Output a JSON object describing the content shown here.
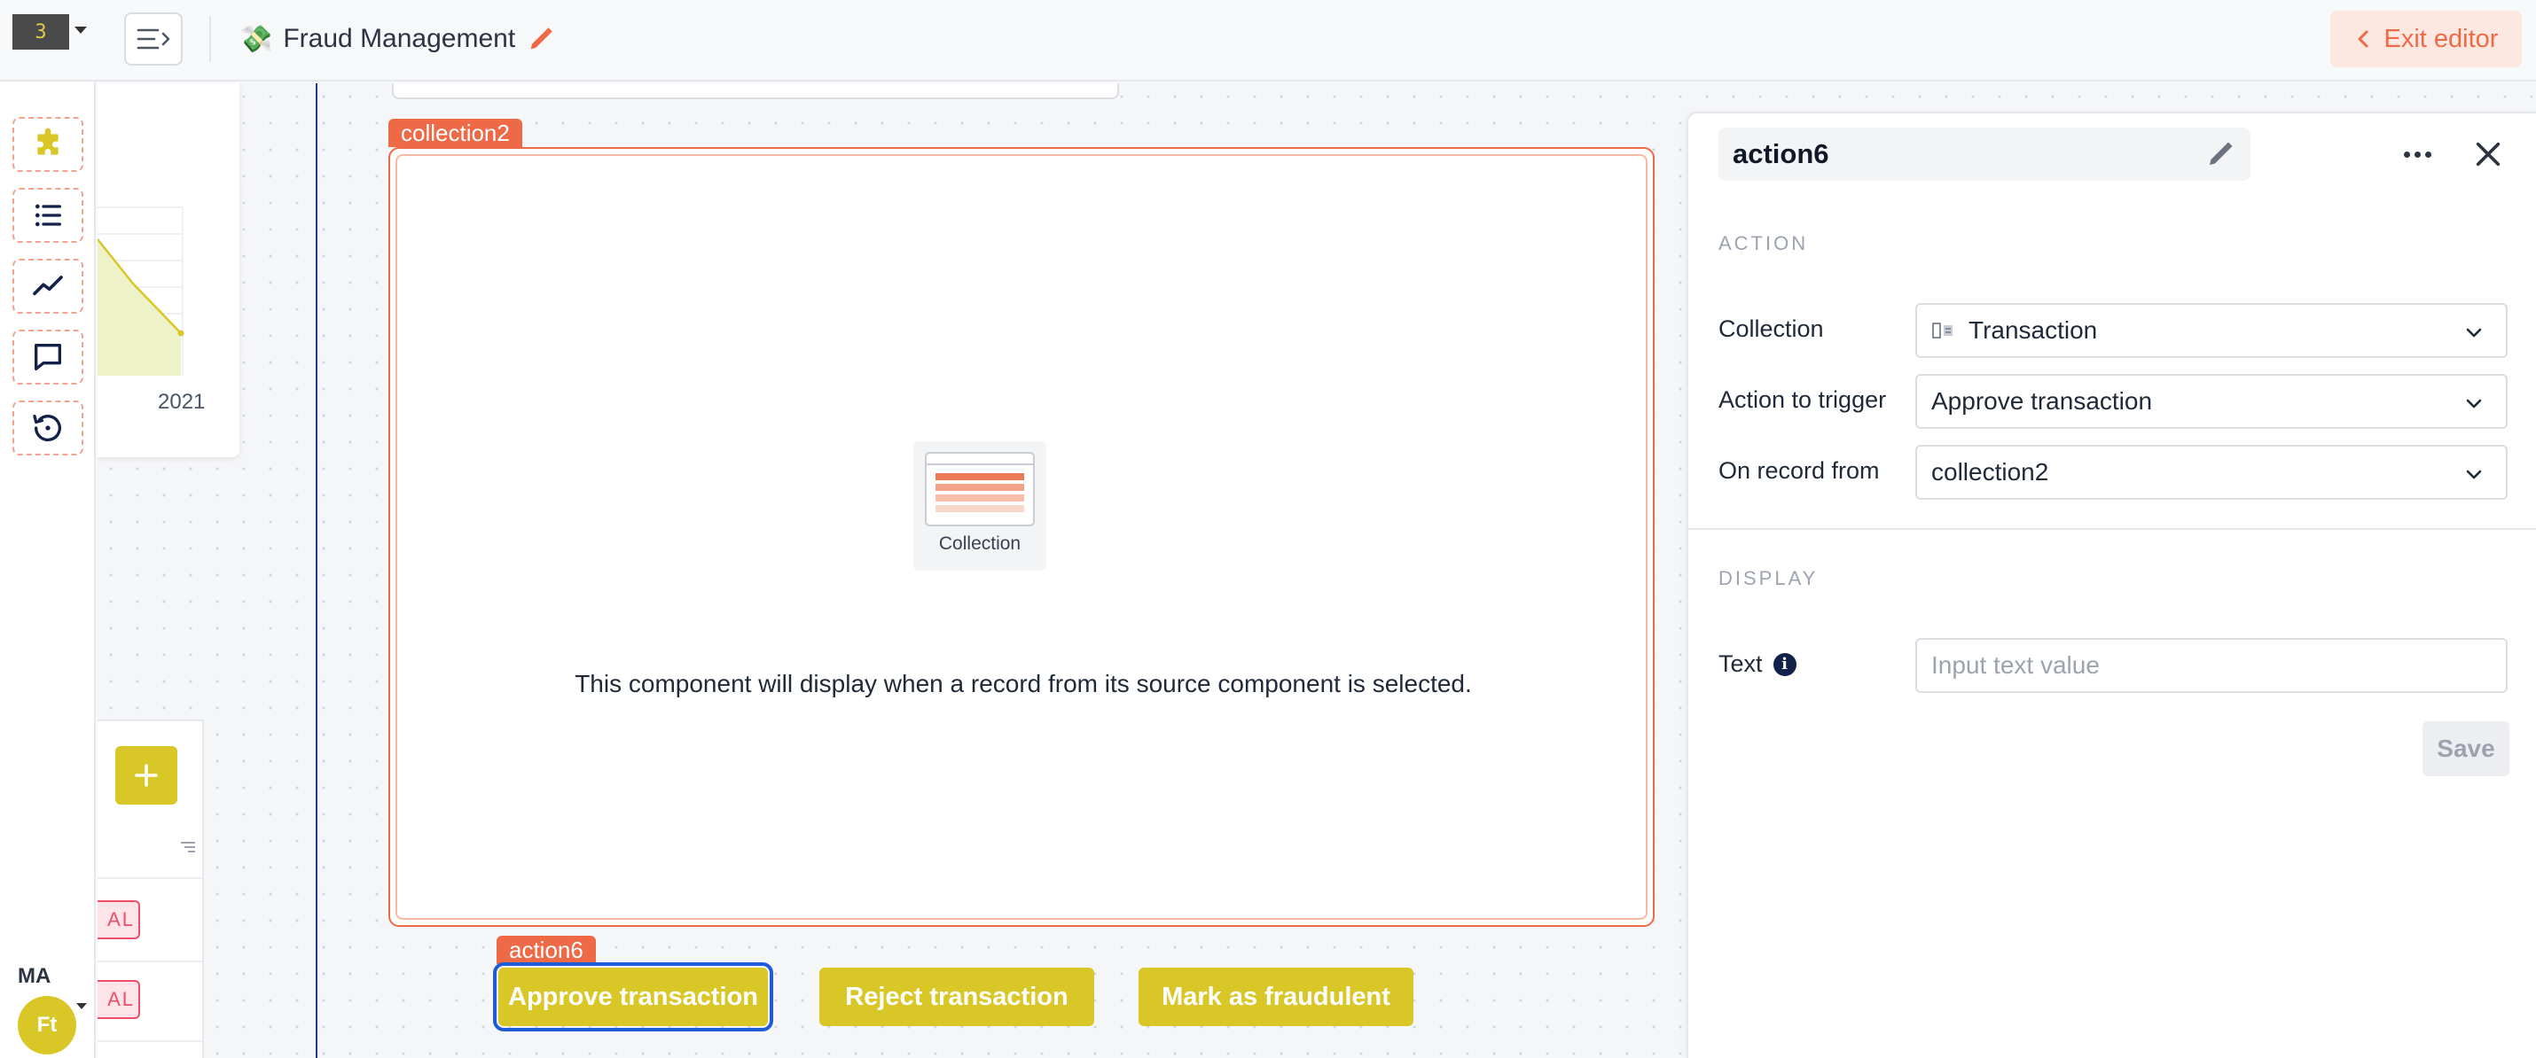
{
  "header": {
    "logo_glyph": "3",
    "app_emoji": "💸",
    "app_title": "Fraud Management",
    "exit_label": "Exit editor"
  },
  "sidebar": {
    "tools": [
      "puzzle-icon",
      "list-icon",
      "line-chart-icon",
      "chat-icon",
      "history-icon"
    ],
    "user_initials": "MA",
    "team_initials": "Ft"
  },
  "canvas": {
    "chart_year_label": "2021",
    "badge_fragment": "AL",
    "collection": {
      "tag": "collection2",
      "icon_label": "Collection",
      "message": "This component will display when a record from its source component is selected."
    },
    "actions": {
      "tag": "action6",
      "buttons": [
        "Approve transaction",
        "Reject transaction",
        "Mark as fraudulent"
      ]
    }
  },
  "panel": {
    "component_name": "action6",
    "action_section": "ACTION",
    "fields": {
      "collection_label": "Collection",
      "collection_value": "Transaction",
      "trigger_label": "Action to trigger",
      "trigger_value": "Approve transaction",
      "record_label": "On record from",
      "record_value": "collection2"
    },
    "display_section": "DISPLAY",
    "text_label": "Text",
    "text_placeholder": "Input text value",
    "save_label": "Save"
  },
  "colors": {
    "accent": "#ee6a46",
    "brand_yellow": "#d9c728",
    "selection_blue": "#1e5bd8"
  }
}
